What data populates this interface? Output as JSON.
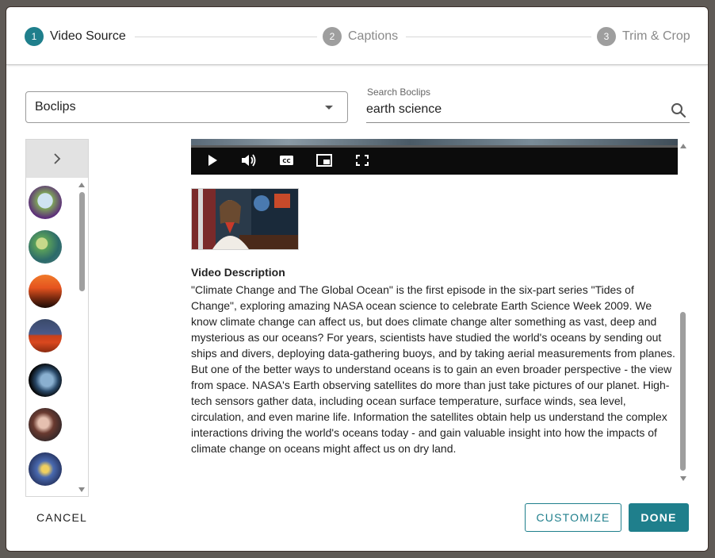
{
  "stepper": {
    "steps": [
      {
        "number": "1",
        "label": "Video Source",
        "active": true
      },
      {
        "number": "2",
        "label": "Captions",
        "active": false
      },
      {
        "number": "3",
        "label": "Trim & Crop",
        "active": false
      }
    ]
  },
  "source": {
    "selected": "Boclips"
  },
  "search": {
    "label": "Search Boclips",
    "value": "earth science"
  },
  "thumbnails": {
    "toggle_icon": "chevron-right-icon",
    "items": [
      "thumb-1",
      "thumb-2",
      "thumb-3",
      "thumb-4",
      "thumb-5",
      "thumb-6",
      "thumb-7"
    ]
  },
  "player": {
    "controls": [
      "play-icon",
      "volume-icon",
      "closed-captions-icon",
      "picture-in-picture-icon",
      "fullscreen-icon"
    ]
  },
  "video": {
    "description_title": "Video Description",
    "description": "\"Climate Change and The Global Ocean\" is the first episode in the six-part series \"Tides of Change\", exploring amazing NASA ocean science to celebrate Earth Science Week 2009. We know climate change can affect us, but does climate change alter something as vast, deep and mysterious as our oceans? For years, scientists have studied the world's oceans by sending out ships and divers, deploying data-gathering buoys, and by taking aerial measurements from planes. But one of the better ways to understand oceans is to gain an even broader perspective - the view from space. NASA's Earth observing satellites do more than just take pictures of our planet. High-tech sensors gather data, including ocean surface temperature, surface winds, sea level, circulation, and even marine life. Information the satellites obtain help us understand the complex interactions driving the world's oceans today - and gain valuable insight into how the impacts of climate change on oceans might affect us on dry land."
  },
  "footer": {
    "cancel_label": "CANCEL",
    "customize_label": "CUSTOMIZE",
    "done_label": "DONE"
  },
  "colors": {
    "accent": "#1f7f8c",
    "inactive_step": "#9e9e9e"
  }
}
